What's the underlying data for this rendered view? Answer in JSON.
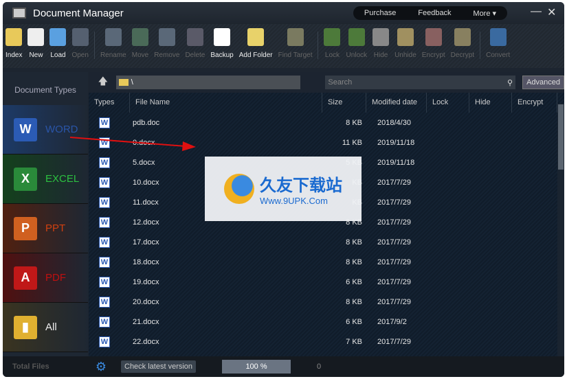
{
  "title": "Document Manager",
  "title_menu": [
    "Purchase",
    "Feedback",
    "More ▾"
  ],
  "toolbar": [
    {
      "label": "Index",
      "enabled": true,
      "color": "#e8c95a"
    },
    {
      "label": "New",
      "enabled": true,
      "color": "#eeeeee"
    },
    {
      "label": "Load",
      "enabled": true,
      "color": "#5aa0e0"
    },
    {
      "label": "Open",
      "enabled": false,
      "color": "#556070"
    },
    {
      "sep": true
    },
    {
      "label": "Rename",
      "enabled": false,
      "color": "#5a6878"
    },
    {
      "label": "Move",
      "enabled": false,
      "color": "#4a6a58"
    },
    {
      "label": "Remove",
      "enabled": false,
      "color": "#5a6878"
    },
    {
      "label": "Delete",
      "enabled": false,
      "color": "#5a5a68"
    },
    {
      "label": "Backup",
      "enabled": true,
      "color": "#ffffff"
    },
    {
      "label": "Add Folder",
      "enabled": true,
      "color": "#e8d26a"
    },
    {
      "label": "Find Target",
      "enabled": false,
      "color": "#7a7a60"
    },
    {
      "sep": true
    },
    {
      "label": "Lock",
      "enabled": false,
      "color": "#4d7a3a"
    },
    {
      "label": "Unlock",
      "enabled": false,
      "color": "#4d7a3a"
    },
    {
      "label": "Hide",
      "enabled": false,
      "color": "#888888"
    },
    {
      "label": "Unhide",
      "enabled": false,
      "color": "#a09060"
    },
    {
      "label": "Encrypt",
      "enabled": false,
      "color": "#886060"
    },
    {
      "label": "Decrypt",
      "enabled": false,
      "color": "#888060"
    },
    {
      "sep": true
    },
    {
      "label": "Convert",
      "enabled": false,
      "color": "#3a6aa0"
    }
  ],
  "sidebar": {
    "header": "Document Types",
    "items": [
      {
        "label": "WORD",
        "icon": "W",
        "color": "#2b5bb5",
        "text_color": "#2a55a8",
        "bg": "#1d3a66"
      },
      {
        "label": "EXCEL",
        "icon": "X",
        "color": "#2a8a3a",
        "text_color": "#2cc040",
        "bg": "#14401c"
      },
      {
        "label": "PPT",
        "icon": "P",
        "color": "#d06020",
        "text_color": "#d04010",
        "bg": "#502010"
      },
      {
        "label": "PDF",
        "icon": "A",
        "color": "#c01818",
        "text_color": "#c01010",
        "bg": "#501010"
      },
      {
        "label": "All",
        "icon": "▮",
        "color": "#e0b030",
        "text_color": "#eeeeee",
        "bg": "#3a3420"
      }
    ]
  },
  "path": "\\",
  "search_placeholder": "Search",
  "advanced": "Advanced",
  "columns": [
    "Types",
    "File Name",
    "Size",
    "Modified date",
    "Lock",
    "Hide",
    "Encrypt"
  ],
  "files": [
    {
      "name": "pdb.doc",
      "size": "8 KB",
      "date": "2018/4/30"
    },
    {
      "name": "0.docx",
      "size": "11 KB",
      "date": "2019/11/18"
    },
    {
      "name": "5.docx",
      "size": "5 KB",
      "date": "2019/11/18"
    },
    {
      "name": "10.docx",
      "size": "KB",
      "date": "2017/7/29"
    },
    {
      "name": "11.docx",
      "size": "KB",
      "date": "2017/7/29"
    },
    {
      "name": "12.docx",
      "size": "8 KB",
      "date": "2017/7/29"
    },
    {
      "name": "17.docx",
      "size": "8 KB",
      "date": "2017/7/29"
    },
    {
      "name": "18.docx",
      "size": "8 KB",
      "date": "2017/7/29"
    },
    {
      "name": "19.docx",
      "size": "6 KB",
      "date": "2017/7/29"
    },
    {
      "name": "20.docx",
      "size": "8 KB",
      "date": "2017/7/29"
    },
    {
      "name": "21.docx",
      "size": "6 KB",
      "date": "2017/9/2"
    },
    {
      "name": "22.docx",
      "size": "7 KB",
      "date": "2017/7/29"
    }
  ],
  "status": {
    "total_files": "Total Files",
    "check": "Check latest version",
    "progress": "100 %",
    "progress_value": 100,
    "count": "0"
  },
  "watermark": {
    "cn": "久友下载站",
    "url": "Www.9UPK.Com"
  }
}
